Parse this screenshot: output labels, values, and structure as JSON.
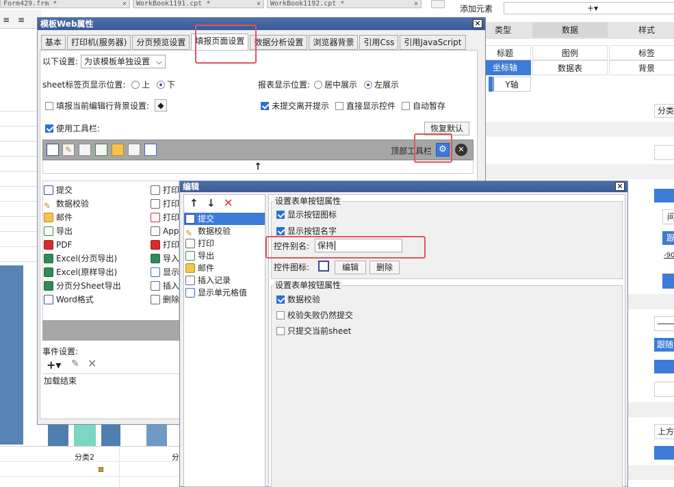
{
  "doc_tabs": [
    {
      "label": "Form429.frm *"
    },
    {
      "label": "WorkBook1191.cpt *"
    },
    {
      "label": "WorkBook1192.cpt *"
    }
  ],
  "ruler_label": "300",
  "right_panel": {
    "add_element_label": "添加元素",
    "add_icon_label": "+▾",
    "headers": [
      "类型",
      "数据",
      "样式"
    ],
    "row1": [
      "标题",
      "图例",
      "标签"
    ],
    "row2": [
      "坐标轴",
      "数据表",
      "背景"
    ],
    "y_axis": "Y轴",
    "side_texts": [
      "分类",
      "间",
      "-90",
      "上方"
    ],
    "side_buttons": [
      "跟",
      "跟随"
    ]
  },
  "chart_bg": {
    "category_label": "分类2",
    "cut_label": "分"
  },
  "dialog1": {
    "title": "模板Web属性",
    "close": "✕",
    "tabs": [
      "基本",
      "打印机(服务器)",
      "分页预览设置",
      "填报页面设置",
      "数据分析设置",
      "浏览器背景",
      "引用Css",
      "引用JavaScript"
    ],
    "settings_label": "以下设置:",
    "settings_value": "为该模板单独设置",
    "sheet_tab_pos_label": "sheet标签页显示位置:",
    "top_label": "上",
    "bottom_label": "下",
    "report_pos_label": "报表显示位置:",
    "center_label": "居中展示",
    "left_label": "左展示",
    "fill_bg_label": "填报当前编辑行背景设置:",
    "unsubmit_label": "未提交离开提示",
    "direct_control_label": "直接显示控件",
    "auto_save_label": "自动暂存",
    "use_toolbar_label": "使用工具栏:",
    "restore_default": "恢复默认",
    "top_toolbar_label": "顶部工具栏",
    "arrow_up": "↑",
    "list_left": [
      "提交",
      "数据校验",
      "邮件",
      "导出",
      "PDF",
      "Excel(分页导出)",
      "Excel(原样导出)",
      "分页分Sheet导出",
      "Word格式"
    ],
    "list_right": [
      "打印",
      "打印",
      "打印",
      "App",
      "打印",
      "导入",
      "显示",
      "插入",
      "删除"
    ],
    "event_label": "事件设置:",
    "event_item": "加载结束"
  },
  "dialog2": {
    "title": "编辑",
    "close": "✕",
    "items": [
      "提交",
      "数据校验",
      "打印",
      "导出",
      "邮件",
      "插入记录",
      "显示单元格值"
    ],
    "group1_title": "设置表单按钮属性",
    "show_icon_label": "显示按钮图标",
    "show_name_label": "显示按钮名字",
    "alias_label": "控件别名:",
    "alias_value": "保持",
    "icon_label": "控件图标:",
    "edit_button": "编辑",
    "delete_button": "删除",
    "group2_title": "设置表单按钮属性",
    "data_check_label": "数据校验",
    "fail_submit_label": "校验失败仍然提交",
    "current_sheet_label": "只提交当前sheet"
  },
  "colors": {
    "accent": "#3d7bd8",
    "highlight": "#e0545f",
    "bar": "#4a7aa8"
  }
}
